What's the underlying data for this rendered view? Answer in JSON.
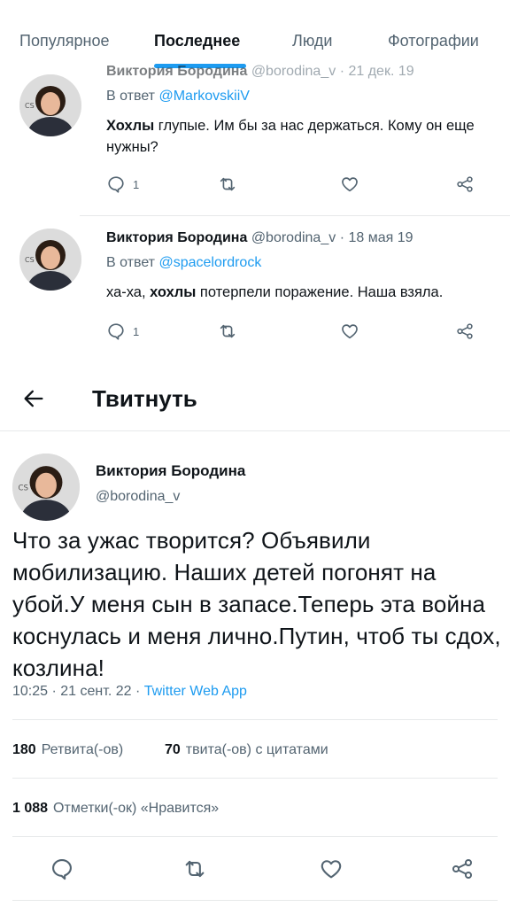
{
  "tabs": [
    {
      "label": "Популярное"
    },
    {
      "label": "Последнее"
    },
    {
      "label": "Люди"
    },
    {
      "label": "Фотографии"
    }
  ],
  "active_tab": "Последнее",
  "accent_color": "#1d9bf0",
  "tweet1": {
    "name": "Виктория Бородина",
    "handle": "@borodina_v",
    "date": "21 дек. 19",
    "reply_prefix": "В ответ",
    "reply_to": "@MarkovskiiV",
    "text_bold": "Хохлы",
    "text_rest": " глупые. Им бы за нас держаться. Кому он еще нужны?",
    "reply_count": "1"
  },
  "tweet2": {
    "name": "Виктория Бородина",
    "handle": "@borodina_v",
    "date": "18 мая 19",
    "reply_prefix": "В ответ",
    "reply_to": "@spacelordrock",
    "text_pre": "ха-ха, ",
    "text_bold": "хохлы",
    "text_rest": " потерпели поражение. Наша взяла.",
    "reply_count": "1"
  },
  "header": {
    "back_icon": "arrow-left-icon",
    "title": "Твитнуть"
  },
  "main_tweet": {
    "name": "Виктория Бородина",
    "handle": "@borodina_v",
    "text": "Что за ужас творится? Объявили мобилизацию. Наших детей погонят на убой.У меня сын в запасе.Теперь эта война коснулась и меня лично.Путин, чтоб ты сдох, козлина!",
    "time": "10:25",
    "date": "21 сент. 22",
    "source": "Twitter Web App",
    "retweets_count": "180",
    "retweets_label": "Ретвита(-ов)",
    "quotes_count": "70",
    "quotes_label": "твита(-ов) с цитатами",
    "likes_count": "1 088",
    "likes_label": "Отметки(-ок) «Нравится»"
  },
  "icons": {
    "reply": "reply-icon",
    "retweet": "retweet-icon",
    "like": "heart-icon",
    "share": "share-icon"
  }
}
